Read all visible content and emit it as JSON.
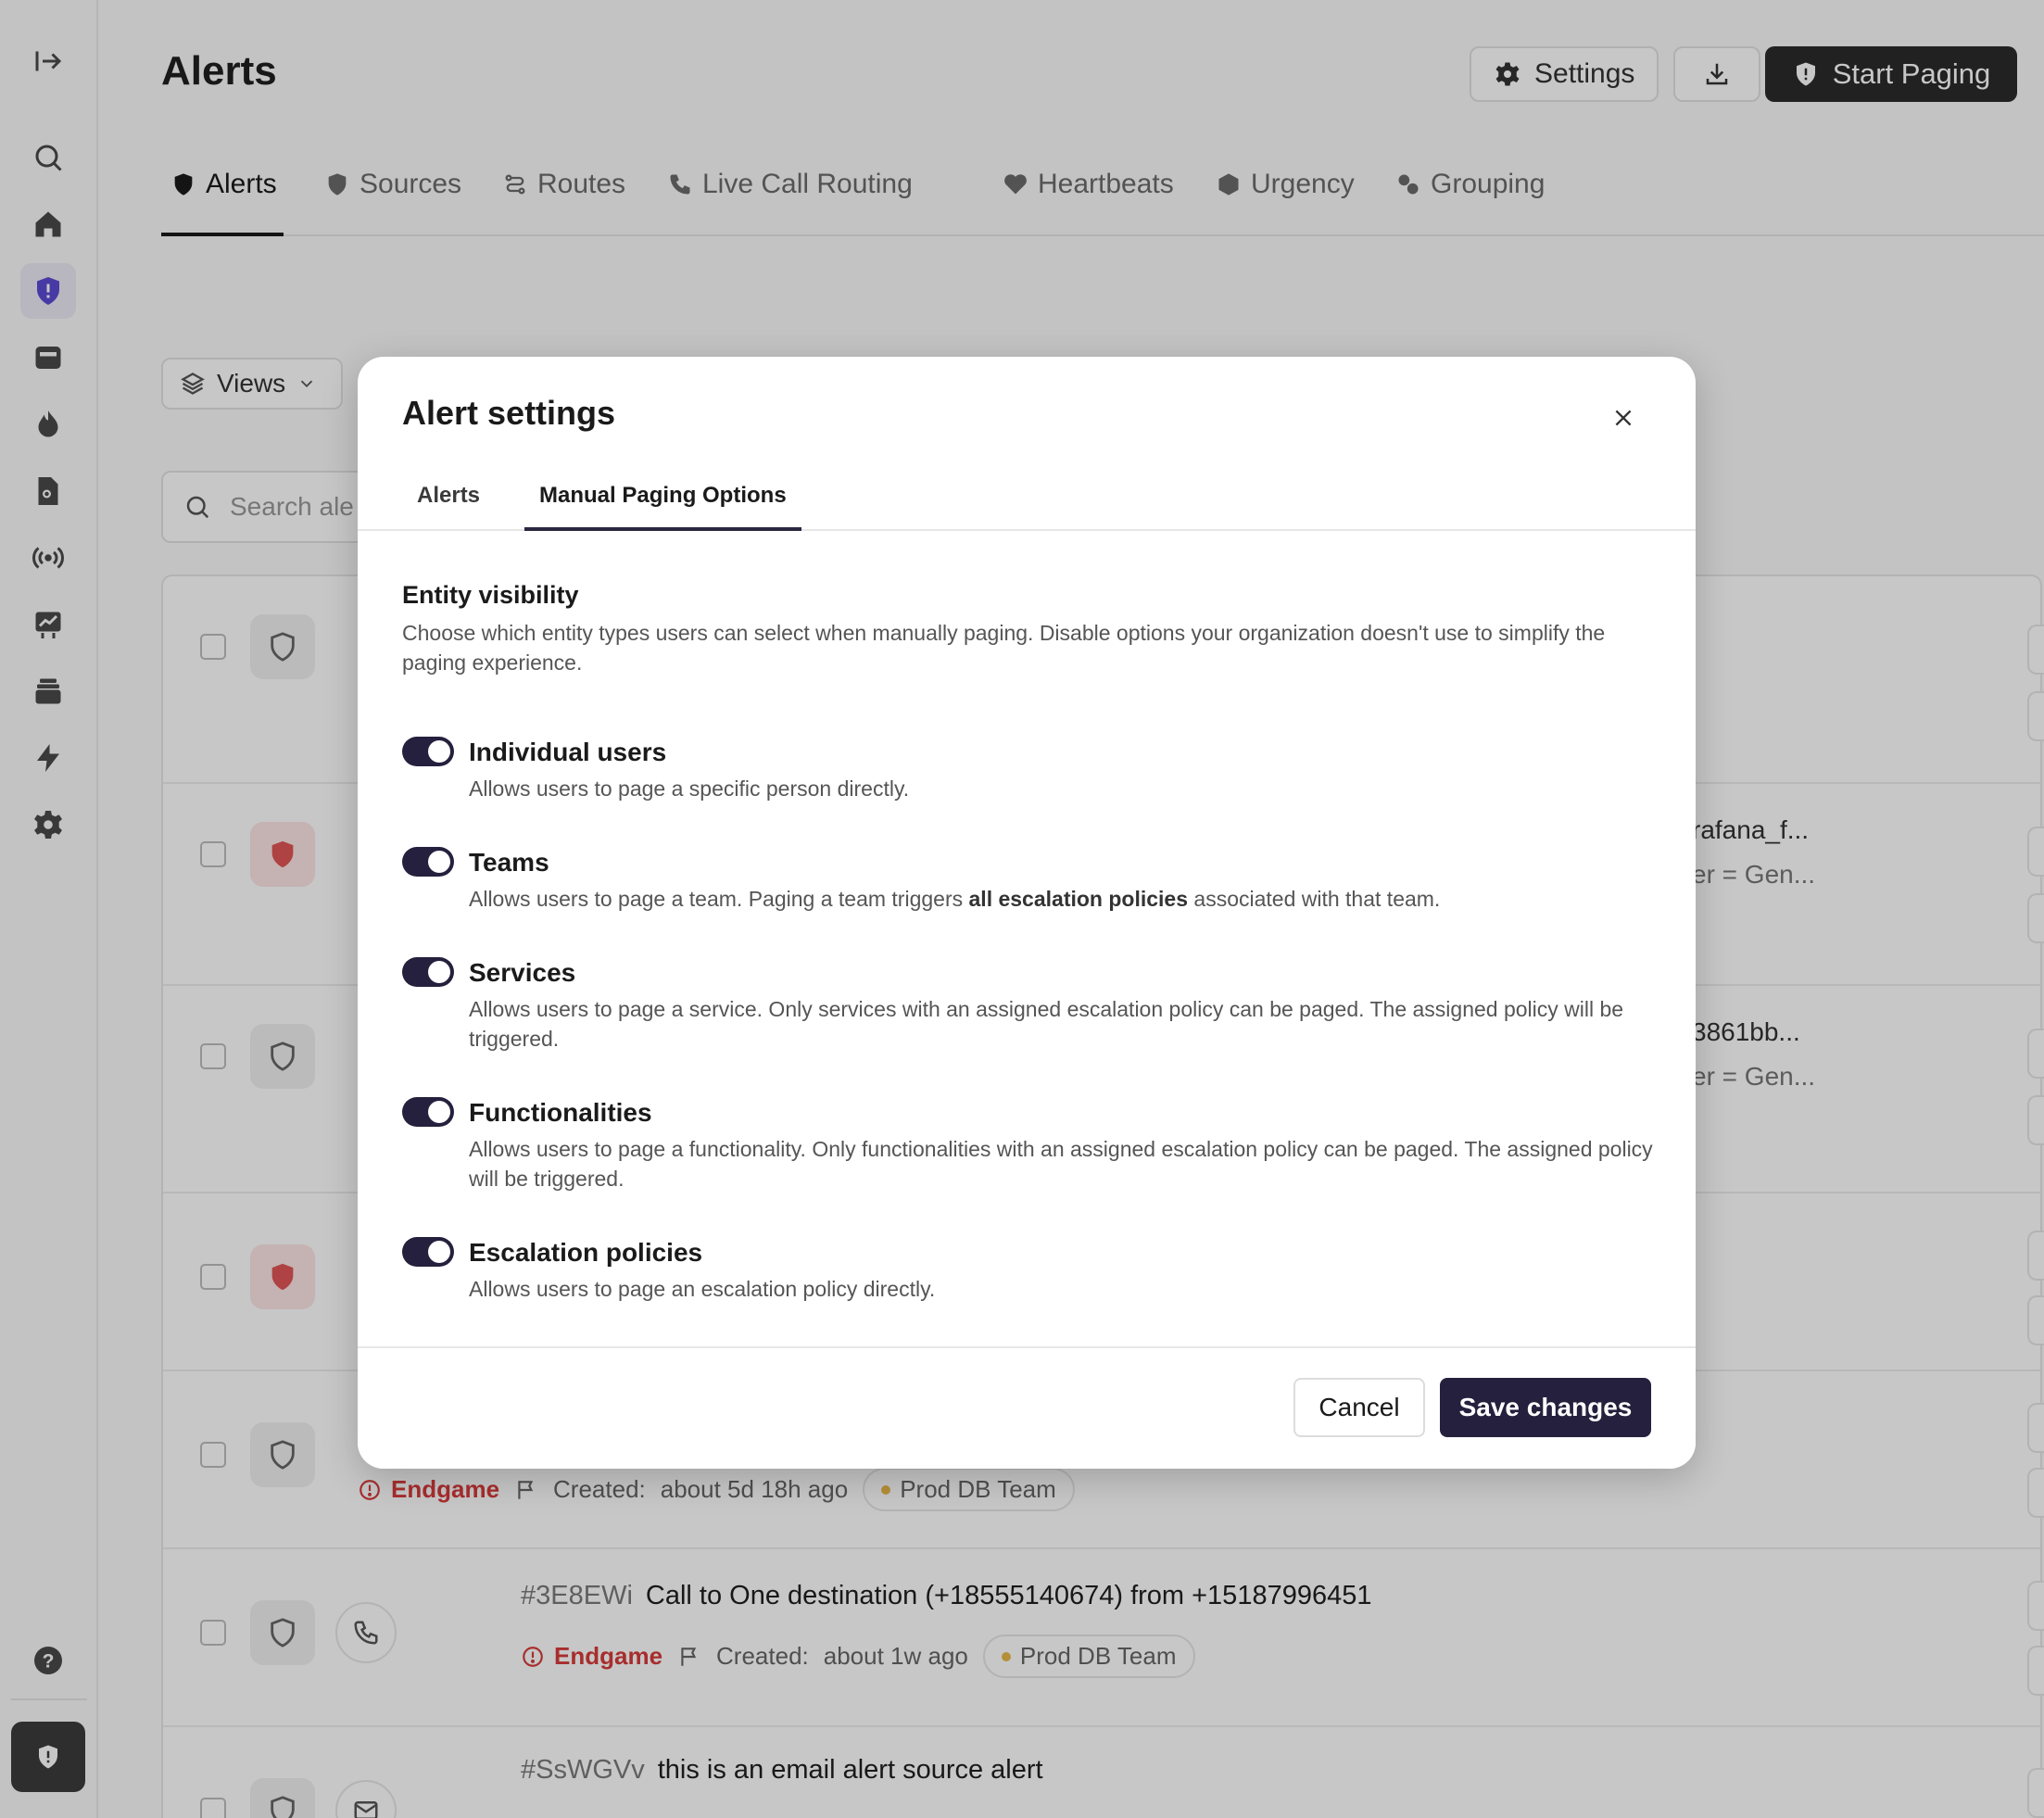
{
  "page": {
    "title": "Alerts",
    "settings_label": "Settings",
    "start_paging_label": "Start Paging"
  },
  "tabs": [
    {
      "label": "Alerts"
    },
    {
      "label": "Sources"
    },
    {
      "label": "Routes"
    },
    {
      "label": "Live Call Routing"
    },
    {
      "label": "Heartbeats"
    },
    {
      "label": "Urgency"
    },
    {
      "label": "Grouping"
    }
  ],
  "toolbar": {
    "views_label": "Views",
    "search_placeholder": "Search ale"
  },
  "rows": [
    {
      "right_line1": "",
      "right_line2": ""
    },
    {
      "right_line1": "rafana_f...",
      "right_line2": "er = Gen..."
    },
    {
      "right_line1": "3861bb...",
      "right_line2": "er = Gen..."
    },
    {
      "right_line1": "",
      "right_line2": ""
    },
    {
      "source": "Endgame",
      "created_label": "Created:",
      "created_value": "about 5d 18h ago",
      "team": "Prod DB Team"
    },
    {
      "id": "#3E8EWi",
      "title": "Call to One destination (+18555140674) from +15187996451",
      "source": "Endgame",
      "created_label": "Created:",
      "created_value": "about 1w ago",
      "team": "Prod DB Team"
    },
    {
      "id": "#SsWGVv",
      "title": "this is an email alert source alert"
    }
  ],
  "modal": {
    "title": "Alert settings",
    "tabs": [
      {
        "label": "Alerts"
      },
      {
        "label": "Manual Paging Options"
      }
    ],
    "section_title": "Entity visibility",
    "section_desc": "Choose which entity types users can select when manually paging. Disable options your organization doesn't use to simplify the paging experience.",
    "options": [
      {
        "title": "Individual users",
        "desc": "Allows users to page a specific person directly.",
        "enabled": true
      },
      {
        "title": "Teams",
        "desc_pre": "Allows users to page a team. Paging a team triggers ",
        "desc_bold": "all escalation policies",
        "desc_post": " associated with that team.",
        "enabled": true
      },
      {
        "title": "Services",
        "desc": "Allows users to page a service. Only services with an assigned escalation policy can be paged. The assigned policy will be triggered.",
        "enabled": true
      },
      {
        "title": "Functionalities",
        "desc": "Allows users to page a functionality. Only functionalities with an assigned escalation policy can be paged. The assigned policy will be triggered.",
        "enabled": true
      },
      {
        "title": "Escalation policies",
        "desc": "Allows users to page an escalation policy directly.",
        "enabled": true
      }
    ],
    "cancel_label": "Cancel",
    "save_label": "Save changes"
  },
  "colors": {
    "accent": "#24203d",
    "source_red": "#d83a3a",
    "sidebar_active": "#5b4bd4"
  }
}
